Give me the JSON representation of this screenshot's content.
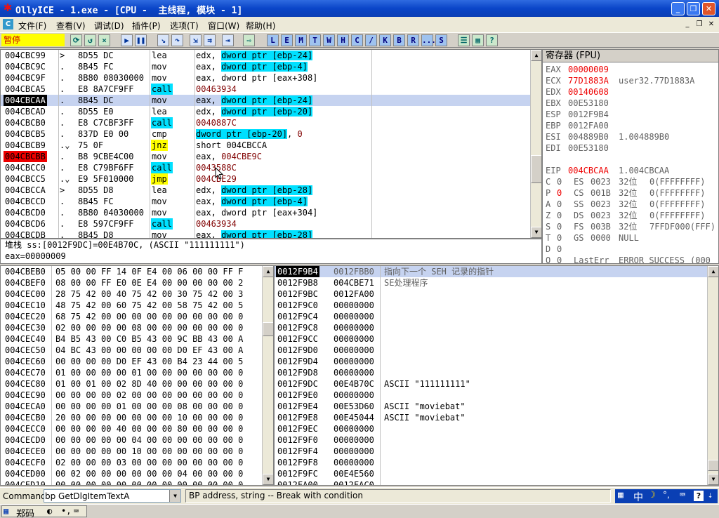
{
  "window": {
    "title": "OllyICE - 1.exe - [CPU -  主线程, 模块 - 1]",
    "icon": "olly-logo-icon"
  },
  "menu": {
    "items": [
      "文件(F)",
      "查看(V)",
      "调试(D)",
      "插件(P)",
      "选项(T)",
      "窗口(W)",
      "帮助(H)"
    ]
  },
  "toolbar": {
    "status": "暂停",
    "letters": [
      "L",
      "E",
      "M",
      "T",
      "W",
      "H",
      "C",
      "/",
      "K",
      "B",
      "R",
      "...",
      "S"
    ]
  },
  "disasm": {
    "rows": [
      {
        "addr": "004CBC99",
        "mark": ">",
        "hex": "8D55 DC",
        "mn": "lea",
        "ops": [
          {
            "t": "edx, "
          },
          {
            "t": "dword ptr [ebp-24]",
            "c": "cyan"
          }
        ]
      },
      {
        "addr": "004CBC9C",
        "mark": ".",
        "hex": "8B45 FC",
        "mn": "mov",
        "ops": [
          {
            "t": "eax, "
          },
          {
            "t": "dword ptr [ebp-4]",
            "c": "cyan"
          }
        ]
      },
      {
        "addr": "004CBC9F",
        "mark": ".",
        "hex": "8B80 08030000",
        "mn": "mov",
        "ops": [
          {
            "t": "eax, dword ptr [eax+308]"
          }
        ]
      },
      {
        "addr": "004CBCA5",
        "mark": ".",
        "hex": "E8 8A7CF9FF",
        "mn": "call",
        "mnc": "cyan",
        "ops": [
          {
            "t": "00463934",
            "c": "maroon"
          }
        ]
      },
      {
        "addr": "004CBCAA",
        "mark": ".",
        "hex": "8B45 DC",
        "mn": "mov",
        "ops": [
          {
            "t": "eax, "
          },
          {
            "t": "dword ptr [ebp-24]",
            "c": "cyan"
          }
        ],
        "sel": true,
        "addrc": "black"
      },
      {
        "addr": "004CBCAD",
        "mark": ".",
        "hex": "8D55 E0",
        "mn": "lea",
        "ops": [
          {
            "t": "edx, "
          },
          {
            "t": "dword ptr [ebp-20]",
            "c": "cyan"
          }
        ]
      },
      {
        "addr": "004CBCB0",
        "mark": ".",
        "hex": "E8 C7CBF3FF",
        "mn": "call",
        "mnc": "cyan",
        "ops": [
          {
            "t": "0040887C",
            "c": "maroon"
          }
        ]
      },
      {
        "addr": "004CBCB5",
        "mark": ".",
        "hex": "837D E0 00",
        "mn": "cmp",
        "ops": [
          {
            "t": "dword ptr [ebp-20]",
            "c": "cyan"
          },
          {
            "t": ", "
          },
          {
            "t": "0",
            "c": "maroon"
          }
        ]
      },
      {
        "addr": "004CBCB9",
        "mark": ".⌄",
        "hex": "75 0F",
        "mn": "jnz",
        "mnc": "yellow",
        "ops": [
          {
            "t": "short 004CBCCA"
          }
        ]
      },
      {
        "addr": "004CBCBB",
        "mark": ".",
        "hex": "B8 9CBE4C00",
        "mn": "mov",
        "ops": [
          {
            "t": "eax, "
          },
          {
            "t": "004CBE9C",
            "c": "maroon"
          }
        ],
        "addrc": "red"
      },
      {
        "addr": "004CBCC0",
        "mark": ".",
        "hex": "E8 C79BF6FF",
        "mn": "call",
        "mnc": "cyan",
        "ops": [
          {
            "t": "0043588C",
            "c": "maroon"
          }
        ]
      },
      {
        "addr": "004CBCC5",
        "mark": ".⌄",
        "hex": "E9 5F010000",
        "mn": "jmp",
        "mnc": "yellow",
        "ops": [
          {
            "t": "004CBE29",
            "c": "maroon"
          }
        ]
      },
      {
        "addr": "004CBCCA",
        "mark": ">",
        "hex": "8D55 D8",
        "mn": "lea",
        "ops": [
          {
            "t": "edx, "
          },
          {
            "t": "dword ptr [ebp-28]",
            "c": "cyan"
          }
        ]
      },
      {
        "addr": "004CBCCD",
        "mark": ".",
        "hex": "8B45 FC",
        "mn": "mov",
        "ops": [
          {
            "t": "eax, "
          },
          {
            "t": "dword ptr [ebp-4]",
            "c": "cyan"
          }
        ]
      },
      {
        "addr": "004CBCD0",
        "mark": ".",
        "hex": "8B80 04030000",
        "mn": "mov",
        "ops": [
          {
            "t": "eax, dword ptr [eax+304]"
          }
        ]
      },
      {
        "addr": "004CBCD6",
        "mark": ".",
        "hex": "E8 597CF9FF",
        "mn": "call",
        "mnc": "cyan",
        "ops": [
          {
            "t": "00463934",
            "c": "maroon"
          }
        ]
      },
      {
        "addr": "004CBCDB",
        "mark": ".",
        "hex": "8B45 D8",
        "mn": "mov",
        "ops": [
          {
            "t": "eax, "
          },
          {
            "t": "dword ptr [ebp-28]",
            "c": "cyan"
          }
        ]
      }
    ]
  },
  "info": {
    "line1": "堆栈 ss:[0012F9DC]=00E4B70C, (ASCII \"111111111\")",
    "line2": "eax=00000009"
  },
  "registers": {
    "header": "寄存器 (FPU)",
    "rows": [
      {
        "name": "EAX",
        "val": "00000009",
        "red": true,
        "note": ""
      },
      {
        "name": "ECX",
        "val": "77D1883A",
        "red": true,
        "note": "user32.77D1883A"
      },
      {
        "name": "EDX",
        "val": "00140608",
        "red": true,
        "note": ""
      },
      {
        "name": "EBX",
        "val": "00E53180",
        "note": ""
      },
      {
        "name": "ESP",
        "val": "0012F9B4",
        "note": ""
      },
      {
        "name": "EBP",
        "val": "0012FA00",
        "note": ""
      },
      {
        "name": "ESI",
        "val": "004889B0",
        "note": "1.004889B0"
      },
      {
        "name": "EDI",
        "val": "00E53180",
        "note": ""
      },
      {
        "name": "",
        "val": "",
        "note": ""
      },
      {
        "name": "EIP",
        "val": "004CBCAA",
        "red": true,
        "note": "1.004CBCAA"
      },
      {
        "name": "",
        "val": "",
        "note": ""
      }
    ],
    "flags": [
      {
        "f": "C",
        "v": "0",
        "seg": "ES",
        "sv": "0023",
        "bits": "32位",
        "desc": "0(FFFFFFFF)"
      },
      {
        "f": "P",
        "v": "0",
        "red": true,
        "seg": "CS",
        "sv": "001B",
        "bits": "32位",
        "desc": "0(FFFFFFFF)"
      },
      {
        "f": "A",
        "v": "0",
        "seg": "SS",
        "sv": "0023",
        "bits": "32位",
        "desc": "0(FFFFFFFF)"
      },
      {
        "f": "Z",
        "v": "0",
        "seg": "DS",
        "sv": "0023",
        "bits": "32位",
        "desc": "0(FFFFFFFF)"
      },
      {
        "f": "S",
        "v": "0",
        "seg": "FS",
        "sv": "003B",
        "bits": "32位",
        "desc": "7FFDF000(FFF)"
      },
      {
        "f": "T",
        "v": "0",
        "seg": "GS",
        "sv": "0000",
        "bits": "NULL",
        "desc": ""
      },
      {
        "f": "D",
        "v": "0",
        "seg": "",
        "sv": "",
        "bits": "",
        "desc": ""
      },
      {
        "f": "O",
        "v": "0",
        "seg": "LastErr",
        "sv": "ERROR_SUCCESS",
        "bits": "",
        "desc": "(000"
      }
    ]
  },
  "dump": {
    "rows": [
      {
        "a": "004CBEB0",
        "h": "05 00 00 FF 14 0F E4 00 06 00 00 FF F"
      },
      {
        "a": "004CBEF0",
        "h": "08 00 00 FF E0 0E E4 00 00 00 00 00 2"
      },
      {
        "a": "004CEC00",
        "h": "28 75 42 00 40 75 42 00 30 75 42 00 3"
      },
      {
        "a": "004CEC10",
        "h": "48 75 42 00 60 75 42 00 58 75 42 00 5"
      },
      {
        "a": "004CEC20",
        "h": "68 75 42 00 00 00 00 00 00 00 00 00 0"
      },
      {
        "a": "004CEC30",
        "h": "02 00 00 00 00 08 00 00 00 00 00 00 0"
      },
      {
        "a": "004CEC40",
        "h": "B4 B5 43 00 C0 B5 43 00 9C BB 43 00 A"
      },
      {
        "a": "004CEC50",
        "h": "04 BC 43 00 00 00 00 00 D0 EF 43 00 A"
      },
      {
        "a": "004CEC60",
        "h": "00 00 00 00 D0 EF 43 00 B4 23 44 00 5"
      },
      {
        "a": "004CEC70",
        "h": "01 00 00 00 00 01 00 00 00 00 00 00 0"
      },
      {
        "a": "004CEC80",
        "h": "01 00 01 00 02 8D 40 00 00 00 00 00 0"
      },
      {
        "a": "004CEC90",
        "h": "00 00 00 00 02 00 00 00 00 00 00 00 0"
      },
      {
        "a": "004CECA0",
        "h": "00 00 00 00 01 00 00 00 08 00 00 00 0"
      },
      {
        "a": "004CECB0",
        "h": "20 00 00 00 00 00 00 00 10 00 00 00 0"
      },
      {
        "a": "004CECC0",
        "h": "00 00 00 00 40 00 00 00 80 00 00 00 0"
      },
      {
        "a": "004CECD0",
        "h": "00 00 00 00 00 04 00 00 00 00 00 00 0"
      },
      {
        "a": "004CECE0",
        "h": "00 00 00 00 00 10 00 00 00 00 00 00 0"
      },
      {
        "a": "004CECF0",
        "h": "02 00 00 00 03 00 00 00 00 00 00 00 0"
      },
      {
        "a": "004CED00",
        "h": "00 02 00 00 00 00 00 00 04 00 00 00 0"
      },
      {
        "a": "004CED10",
        "h": "00 00 00 00 00 00 00 00 00 00 00 00 0"
      }
    ]
  },
  "stack": {
    "rows": [
      {
        "a": "0012F9B4",
        "v": "0012FBB0",
        "c": "指向下一个 SEH 记录的指针",
        "sel": true
      },
      {
        "a": "0012F9B8",
        "v": "004CBE71",
        "c": "SE处理程序"
      },
      {
        "a": "0012F9BC",
        "v": "0012FA00",
        "c": ""
      },
      {
        "a": "0012F9C0",
        "v": "00000000",
        "c": ""
      },
      {
        "a": "0012F9C4",
        "v": "00000000",
        "c": ""
      },
      {
        "a": "0012F9C8",
        "v": "00000000",
        "c": ""
      },
      {
        "a": "0012F9CC",
        "v": "00000000",
        "c": ""
      },
      {
        "a": "0012F9D0",
        "v": "00000000",
        "c": ""
      },
      {
        "a": "0012F9D4",
        "v": "00000000",
        "c": ""
      },
      {
        "a": "0012F9D8",
        "v": "00000000",
        "c": ""
      },
      {
        "a": "0012F9DC",
        "v": "00E4B70C",
        "c": "ASCII \"111111111\""
      },
      {
        "a": "0012F9E0",
        "v": "00000000",
        "c": ""
      },
      {
        "a": "0012F9E4",
        "v": "00E53D60",
        "c": "ASCII \"moviebat\""
      },
      {
        "a": "0012F9E8",
        "v": "00E45044",
        "c": "ASCII \"moviebat\""
      },
      {
        "a": "0012F9EC",
        "v": "00000000",
        "c": ""
      },
      {
        "a": "0012F9F0",
        "v": "00000000",
        "c": ""
      },
      {
        "a": "0012F9F4",
        "v": "00000000",
        "c": ""
      },
      {
        "a": "0012F9F8",
        "v": "00000000",
        "c": ""
      },
      {
        "a": "0012F9FC",
        "v": "00E4E560",
        "c": ""
      },
      {
        "a": "0012FA00",
        "v": "0012FAC0",
        "c": ""
      }
    ]
  },
  "command": {
    "label": "Command",
    "value": "bp GetDlgItemTextA",
    "hint": "BP address, string -- Break with condition"
  },
  "tray": {
    "ime": "中",
    "punct": "°,"
  },
  "taskbar": {
    "ime_name": "郑码"
  }
}
